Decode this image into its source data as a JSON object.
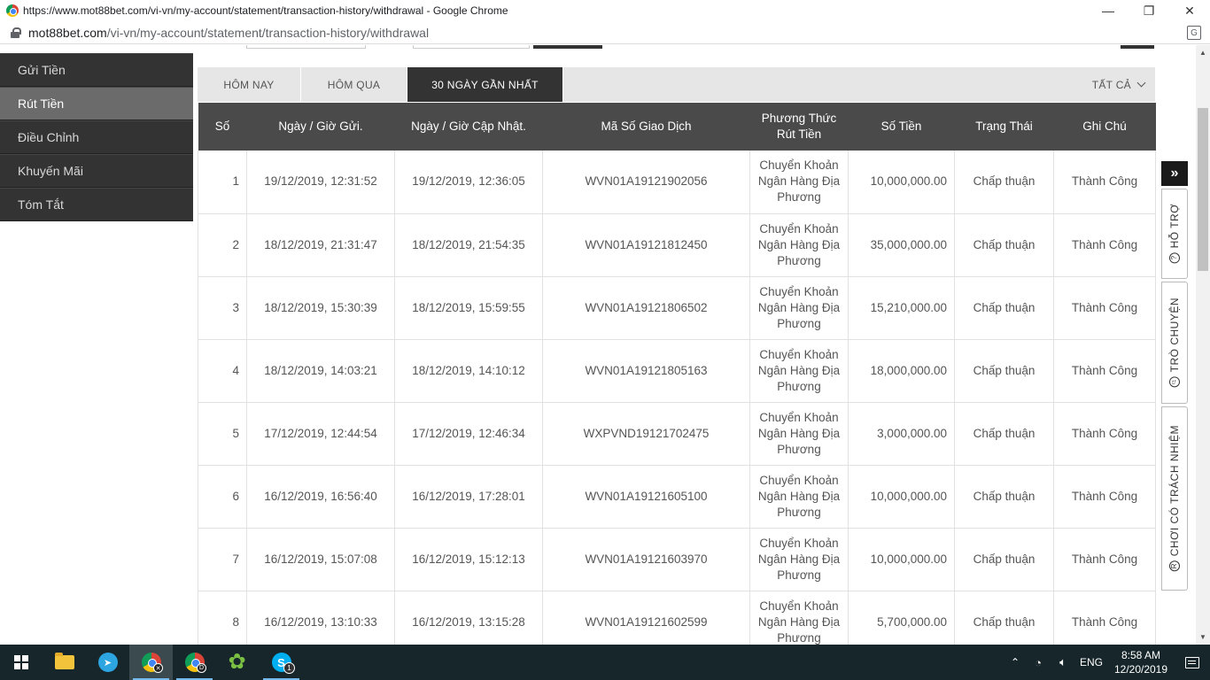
{
  "browser": {
    "title": "https://www.mot88bet.com/vi-vn/my-account/statement/transaction-history/withdrawal - Google Chrome",
    "url_domain": "mot88bet.com",
    "url_path": "/vi-vn/my-account/statement/transaction-history/withdrawal",
    "minimize": "—",
    "restore": "❐",
    "close": "✕"
  },
  "sidebar": {
    "items": [
      {
        "label": "Gửi Tiền",
        "active": false
      },
      {
        "label": "Rút Tiền",
        "active": true
      },
      {
        "label": "Điều Chỉnh",
        "active": false
      },
      {
        "label": "Khuyến Mãi",
        "active": false
      },
      {
        "label": "Tóm Tắt",
        "active": false
      }
    ]
  },
  "tabs": {
    "today": "HÔM NAY",
    "yesterday": "HÔM QUA",
    "last30": "30 NGÀY GẦN NHẤT",
    "filter": "TẤT CẢ"
  },
  "table": {
    "headers": [
      "Số",
      "Ngày / Giờ Gửi.",
      "Ngày / Giờ Cập Nhật.",
      "Mã Số Giao Dịch",
      "Phương Thức Rút Tiền",
      "Số Tiền",
      "Trạng Thái",
      "Ghi Chú"
    ],
    "rows": [
      [
        "1",
        "19/12/2019, 12:31:52",
        "19/12/2019, 12:36:05",
        "WVN01A19121902056",
        "Chuyển Khoản Ngân Hàng Địa Phương",
        "10,000,000.00",
        "Chấp thuận",
        "Thành Công"
      ],
      [
        "2",
        "18/12/2019, 21:31:47",
        "18/12/2019, 21:54:35",
        "WVN01A19121812450",
        "Chuyển Khoản Ngân Hàng Địa Phương",
        "35,000,000.00",
        "Chấp thuận",
        "Thành Công"
      ],
      [
        "3",
        "18/12/2019, 15:30:39",
        "18/12/2019, 15:59:55",
        "WVN01A19121806502",
        "Chuyển Khoản Ngân Hàng Địa Phương",
        "15,210,000.00",
        "Chấp thuận",
        "Thành Công"
      ],
      [
        "4",
        "18/12/2019, 14:03:21",
        "18/12/2019, 14:10:12",
        "WVN01A19121805163",
        "Chuyển Khoản Ngân Hàng Địa Phương",
        "18,000,000.00",
        "Chấp thuận",
        "Thành Công"
      ],
      [
        "5",
        "17/12/2019, 12:44:54",
        "17/12/2019, 12:46:34",
        "WXPVND19121702475",
        "Chuyển Khoản Ngân Hàng Địa Phương",
        "3,000,000.00",
        "Chấp thuận",
        "Thành Công"
      ],
      [
        "6",
        "16/12/2019, 16:56:40",
        "16/12/2019, 17:28:01",
        "WVN01A19121605100",
        "Chuyển Khoản Ngân Hàng Địa Phương",
        "10,000,000.00",
        "Chấp thuận",
        "Thành Công"
      ],
      [
        "7",
        "16/12/2019, 15:07:08",
        "16/12/2019, 15:12:13",
        "WVN01A19121603970",
        "Chuyển Khoản Ngân Hàng Địa Phương",
        "10,000,000.00",
        "Chấp thuận",
        "Thành Công"
      ],
      [
        "8",
        "16/12/2019, 13:10:33",
        "16/12/2019, 13:15:28",
        "WVN01A19121602599",
        "Chuyển Khoản Ngân Hàng Địa Phương",
        "5,700,000.00",
        "Chấp thuận",
        "Thành Công"
      ]
    ]
  },
  "float_panel": {
    "toggle": "»",
    "support": "HỖ TRỢ",
    "chat": "TRÒ CHUYỆN",
    "responsible": "CHƠI CÓ TRÁCH NHIỆM"
  },
  "taskbar": {
    "skype_count": "1",
    "lang": "ENG",
    "time": "8:58 AM",
    "date": "12/20/2019"
  },
  "colors": {
    "sidebar_bg": "#333333",
    "sidebar_active": "#6b6b6b",
    "table_header": "#4a4a4a",
    "tab_active": "#333333",
    "taskbar": "#16262b"
  }
}
